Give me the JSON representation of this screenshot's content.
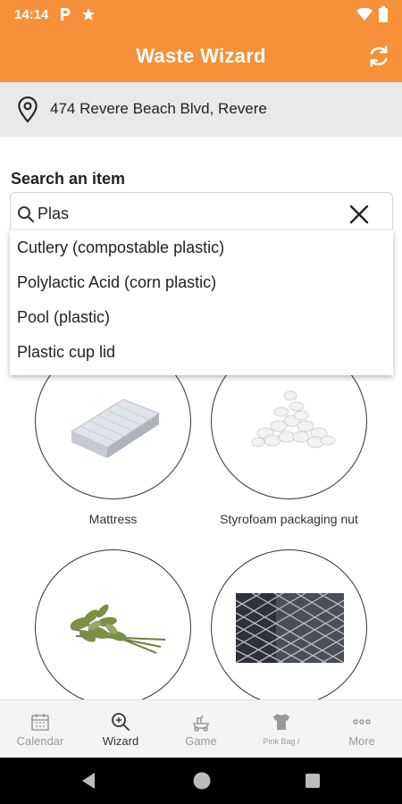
{
  "status_bar": {
    "time": "14:14",
    "icons": [
      "parking-icon",
      "star-icon",
      "wifi-icon",
      "battery-icon"
    ]
  },
  "app_bar": {
    "title": "Waste Wizard",
    "refresh_icon": "refresh-icon"
  },
  "location": {
    "address": "474 Revere Beach Blvd, Revere",
    "icon": "location-pin-icon"
  },
  "search": {
    "label": "Search an item",
    "value": "Plas",
    "suggestions": [
      "Cutlery (compostable plastic)",
      "Polylactic Acid (corn plastic)",
      "Pool (plastic)",
      "Plastic cup lid"
    ]
  },
  "items": [
    {
      "caption": "Mattress",
      "image": "mattress"
    },
    {
      "caption": "Styrofoam packaging nut",
      "image": "styrofoam-peanuts"
    },
    {
      "caption": "",
      "image": "plant-trimmings"
    },
    {
      "caption": "",
      "image": "chain-link-fence"
    }
  ],
  "bottom_nav": {
    "items": [
      {
        "label": "Calendar",
        "icon": "calendar-icon",
        "active": false
      },
      {
        "label": "Wizard",
        "icon": "wizard-search-icon",
        "active": true
      },
      {
        "label": "Game",
        "icon": "game-icon",
        "active": false
      },
      {
        "label": "Pink Bag /",
        "icon": "shirt-icon",
        "active": false
      },
      {
        "label": "More",
        "icon": "more-dots-icon",
        "active": false
      }
    ]
  },
  "colors": {
    "accent": "#f6913a",
    "location_bg": "#e9e9e9",
    "nav_bg": "#f4f4f4",
    "active_label": "#333333",
    "inactive_label": "#999999"
  }
}
